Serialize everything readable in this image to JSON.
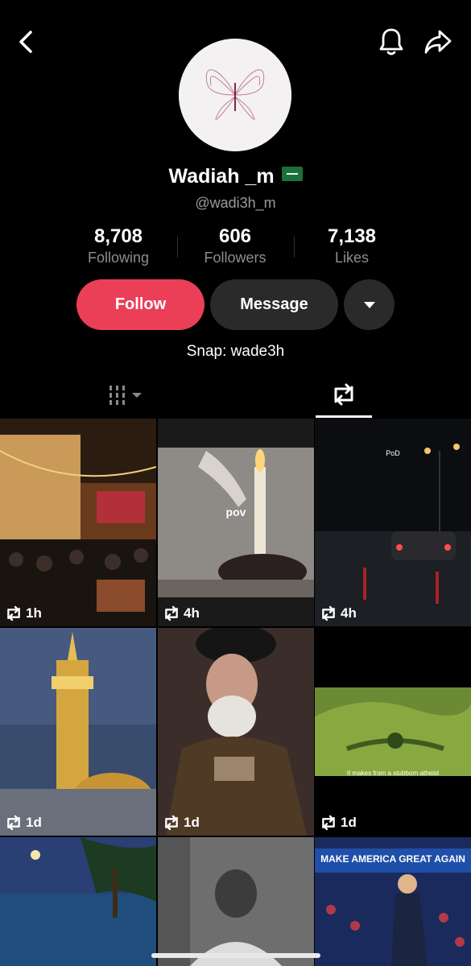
{
  "profile": {
    "display_name": "Wadiah _m",
    "handle": "@wadi3h_m",
    "snap": "Snap: wade3h"
  },
  "stats": [
    {
      "value": "8,708",
      "label": "Following"
    },
    {
      "value": "606",
      "label": "Followers"
    },
    {
      "value": "7,138",
      "label": "Likes"
    }
  ],
  "actions": {
    "follow": "Follow",
    "message": "Message"
  },
  "posts": [
    {
      "time": "1h",
      "caption": ""
    },
    {
      "time": "4h",
      "caption": "pov"
    },
    {
      "time": "4h",
      "caption": "PoD"
    },
    {
      "time": "1d",
      "caption": ""
    },
    {
      "time": "1d",
      "caption": ""
    },
    {
      "time": "1d",
      "caption": "It makes from a stubborn atheist"
    },
    {
      "time": "",
      "caption": ""
    },
    {
      "time": "",
      "caption": ""
    },
    {
      "time": "",
      "caption": "MAKE AMERICA GREAT AGAIN"
    }
  ],
  "colors": {
    "follow": "#ea3f57",
    "secondary_button": "#2a2a2a",
    "background": "#000000"
  }
}
